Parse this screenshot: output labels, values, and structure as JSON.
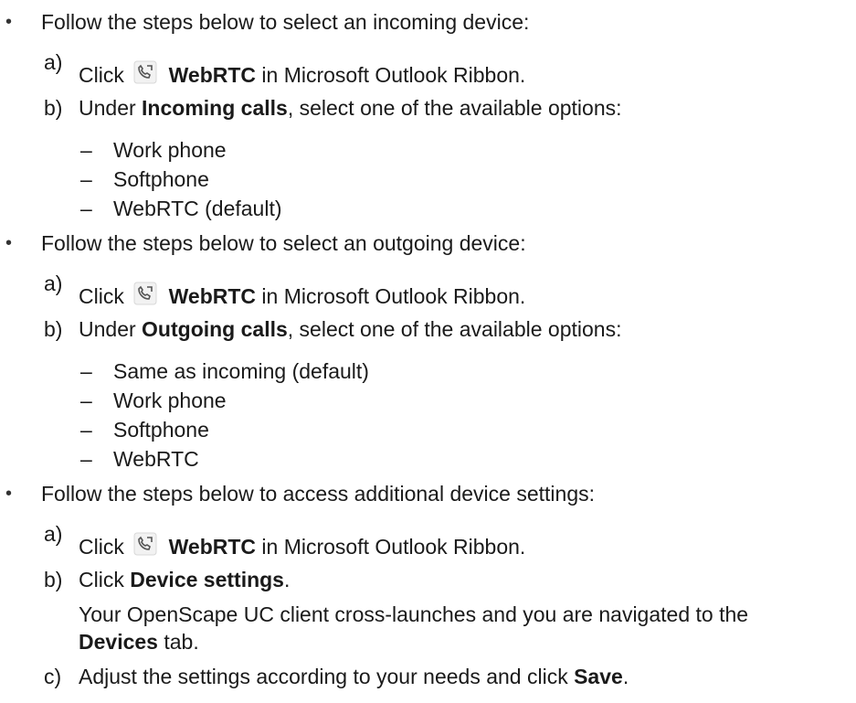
{
  "sections": [
    {
      "bullet": "•",
      "intro": "Follow the steps below to select an incoming device:",
      "step_a": {
        "letter": "a)",
        "pre": "Click",
        "bold": "WebRTC",
        "post": "in Microsoft Outlook Ribbon."
      },
      "step_b": {
        "letter": "b)",
        "pre": "Under ",
        "bold": "Incoming calls",
        "post": ", select one of the available options:"
      },
      "options": [
        "Work phone",
        "Softphone",
        "WebRTC (default)"
      ]
    },
    {
      "bullet": "•",
      "intro": "Follow the steps below to select an outgoing device:",
      "step_a": {
        "letter": "a)",
        "pre": "Click",
        "bold": "WebRTC",
        "post": "in Microsoft Outlook Ribbon."
      },
      "step_b": {
        "letter": "b)",
        "pre": "Under ",
        "bold": "Outgoing calls",
        "post": ", select one of the available options:"
      },
      "options": [
        "Same as incoming (default)",
        "Work phone",
        "Softphone",
        "WebRTC"
      ]
    },
    {
      "bullet": "•",
      "intro": "Follow the steps below to access additional device settings:",
      "step_a": {
        "letter": "a)",
        "pre": "Click",
        "bold": "WebRTC",
        "post": "in Microsoft Outlook Ribbon."
      },
      "step_b": {
        "letter": "b)",
        "pre": "Click ",
        "bold": "Device settings",
        "post": "."
      },
      "result_line1": "Your OpenScape UC client cross-launches and you are navigated to the",
      "result_bold": "Devices",
      "result_post": " tab.",
      "step_c": {
        "letter": "c)",
        "pre": "Adjust the settings according to your needs and click ",
        "bold": "Save",
        "post": "."
      }
    }
  ],
  "dash": "–",
  "icon": "webrtc-phone-icon"
}
